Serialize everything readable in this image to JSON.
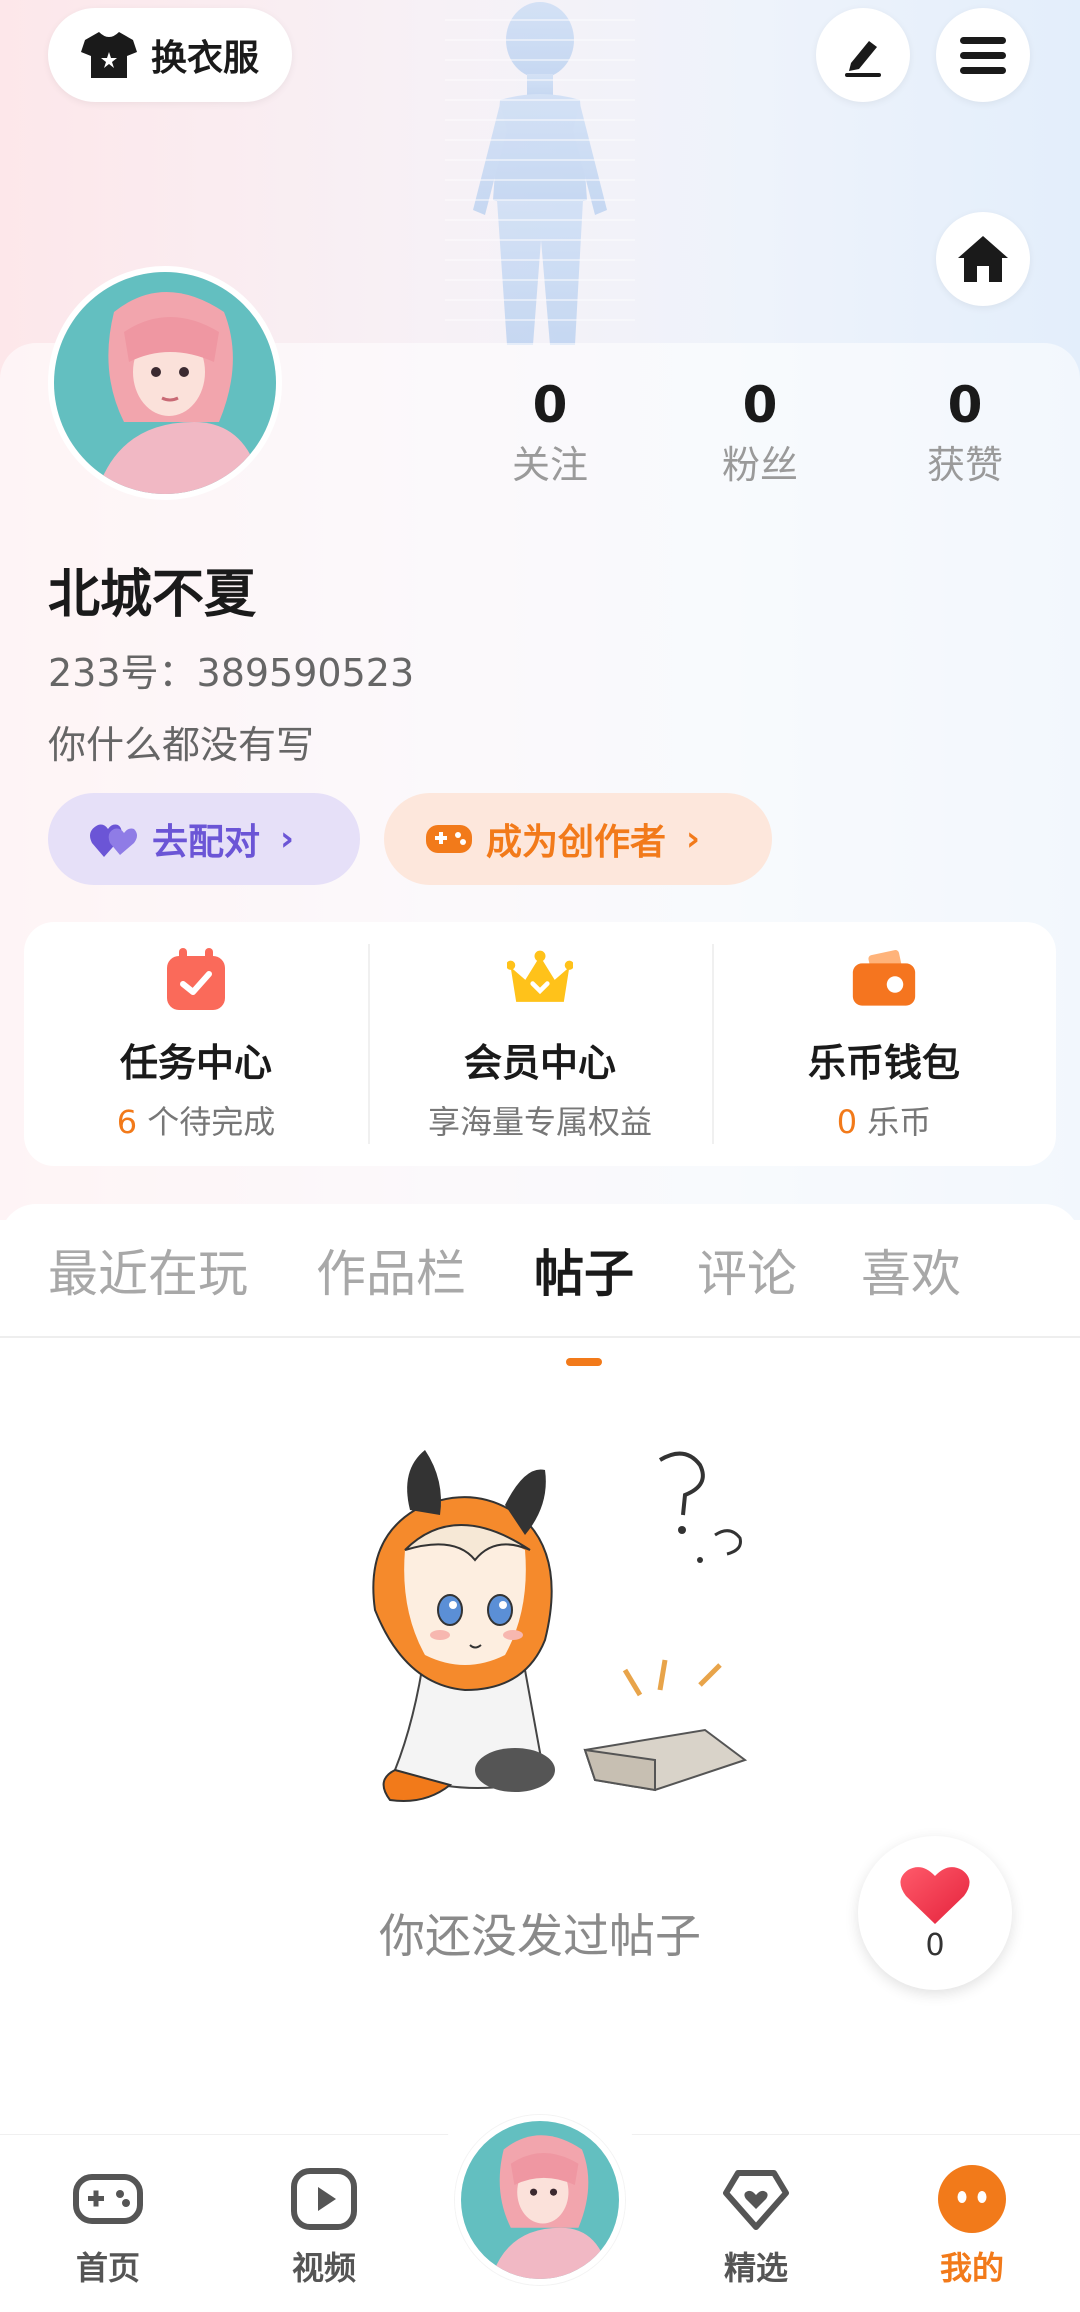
{
  "top_bar": {
    "outfit_label": "换衣服",
    "outfit_icon": "tshirt-icon",
    "edit_icon": "pen-icon",
    "menu_icon": "hamburger-menu-icon",
    "home_icon": "home-icon"
  },
  "profile": {
    "name": "北城不夏",
    "uid": "233号：389590523",
    "bio": "你什么都没有写",
    "stats": [
      {
        "value": "0",
        "label": "关注"
      },
      {
        "value": "0",
        "label": "粉丝"
      },
      {
        "value": "0",
        "label": "获赞"
      }
    ]
  },
  "actions": {
    "pair_label": "去配对",
    "creator_label": "成为创作者",
    "chevron": "›"
  },
  "services": [
    {
      "title": "任务中心",
      "sub_highlight": "6",
      "sub_text": " 个待完成",
      "icon": "calendar-check-icon"
    },
    {
      "title": "会员中心",
      "sub_highlight": "",
      "sub_text": "享海量专属权益",
      "icon": "crown-icon"
    },
    {
      "title": "乐币钱包",
      "sub_highlight": "0",
      "sub_text": " 乐币",
      "icon": "wallet-icon"
    }
  ],
  "tabs": [
    {
      "label": "最近在玩",
      "active": false
    },
    {
      "label": "作品栏",
      "active": false
    },
    {
      "label": "帖子",
      "active": true
    },
    {
      "label": "评论",
      "active": false
    },
    {
      "label": "喜欢",
      "active": false
    }
  ],
  "empty_state": {
    "message": "你还没发过帖子"
  },
  "like_fab": {
    "count": "0"
  },
  "bottom_nav": [
    {
      "label": "首页",
      "icon": "gamepad-icon",
      "active": false
    },
    {
      "label": "视频",
      "icon": "play-icon",
      "active": false
    },
    {
      "label": "精选",
      "icon": "heart-diamond-icon",
      "active": false
    },
    {
      "label": "我的",
      "icon": "face-icon",
      "active": true
    }
  ],
  "colors": {
    "accent": "#f27a1a",
    "pair_purple": "#6b55d6"
  }
}
